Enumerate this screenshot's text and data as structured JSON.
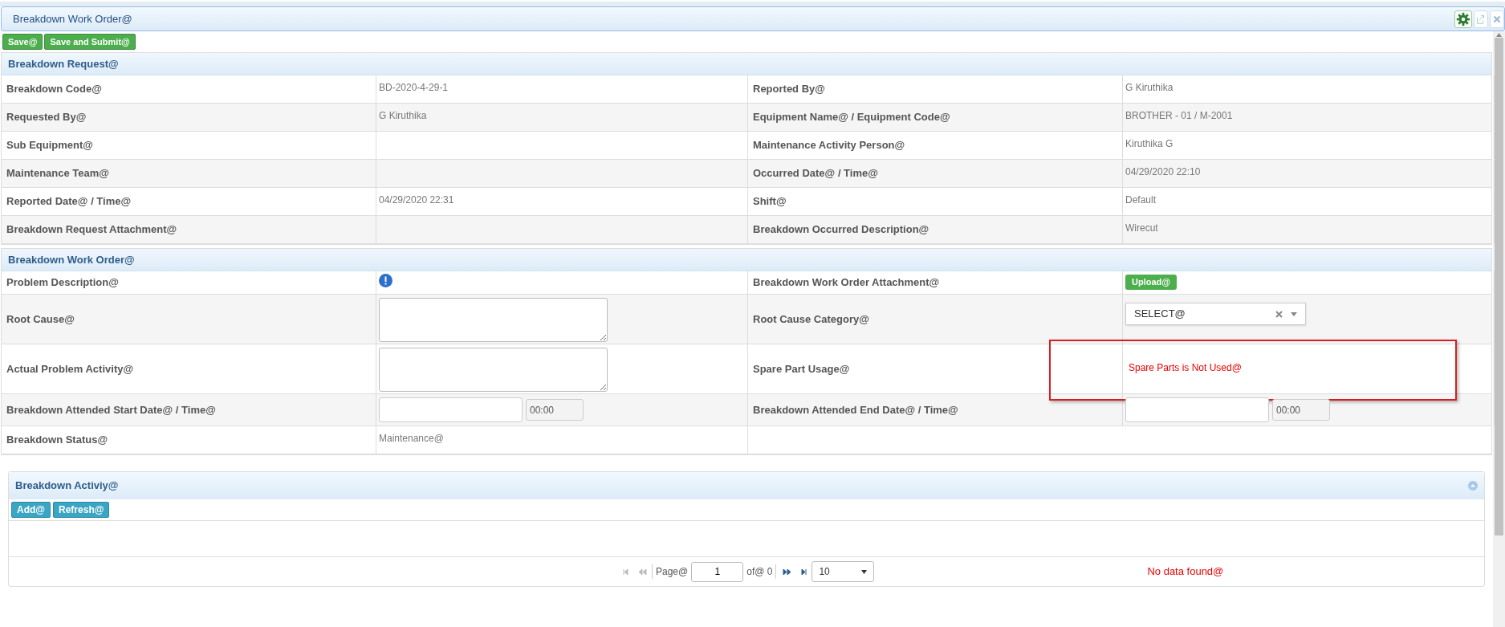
{
  "window": {
    "title": "Breakdown Work Order@"
  },
  "toolbar": {
    "buttons": [
      "Save@",
      "Save and Submit@"
    ]
  },
  "request": {
    "title": "Breakdown Request@",
    "rows": [
      {
        "left": {
          "label": "Breakdown Code@",
          "value": "BD-2020-4-29-1"
        },
        "right": {
          "label": "Reported By@",
          "value": "G Kiruthika"
        }
      },
      {
        "left": {
          "label": "Requested By@",
          "value": "G Kiruthika"
        },
        "right": {
          "label": "Equipment Name@ / Equipment Code@",
          "value": "BROTHER - 01 / M-2001"
        }
      },
      {
        "left": {
          "label": "Sub Equipment@"
        },
        "right": {
          "label": "Maintenance Activity Person@",
          "value": "Kiruthika G"
        }
      },
      {
        "left": {
          "label": "Maintenance Team@"
        },
        "right": {
          "label": "Occurred Date@ / Time@",
          "value": "04/29/2020 22:10"
        }
      },
      {
        "left": {
          "label": "Reported Date@ / Time@",
          "value": "04/29/2020 22:31"
        },
        "right": {
          "label": "Shift@",
          "value": "Default"
        }
      },
      {
        "left": {
          "label": "Breakdown Request Attachment@"
        },
        "right": {
          "label": "Breakdown Occurred Description@",
          "value": "Wirecut"
        }
      }
    ]
  },
  "work_order": {
    "title": "Breakdown Work Order@",
    "rows": [
      {
        "left": {
          "label": "Problem Description@",
          "kind": "info"
        },
        "right": {
          "label": "Breakdown Work Order Attachment@",
          "kind": "upload",
          "button": "Upload@"
        }
      },
      {
        "left": {
          "label": "Root Cause@",
          "kind": "textarea"
        },
        "right": {
          "label": "Root Cause Category@",
          "kind": "select",
          "value": "SELECT@"
        }
      },
      {
        "left": {
          "label": "Actual Problem Activity@",
          "kind": "textarea"
        },
        "right": {
          "label": "Spare Part Usage@",
          "kind": "notice",
          "value": "Spare Parts is Not Used@",
          "highlighted": true
        }
      },
      {
        "left": {
          "label": "Breakdown Attended Start Date@ / Time@",
          "kind": "datetime",
          "time": "00:00"
        },
        "right": {
          "label": "Breakdown Attended End Date@ / Time@",
          "kind": "datetime",
          "time": "00:00"
        }
      },
      {
        "left": {
          "label": "Breakdown Status@",
          "kind": "text",
          "value": "Maintenance@"
        }
      }
    ]
  },
  "activity": {
    "title": "Breakdown Activiy@",
    "buttons": [
      "Add@",
      "Refresh@"
    ],
    "pager": {
      "page_label": "Page@",
      "page": "1",
      "of": "of@ 0",
      "page_size": "10",
      "message": "No data found@"
    }
  }
}
